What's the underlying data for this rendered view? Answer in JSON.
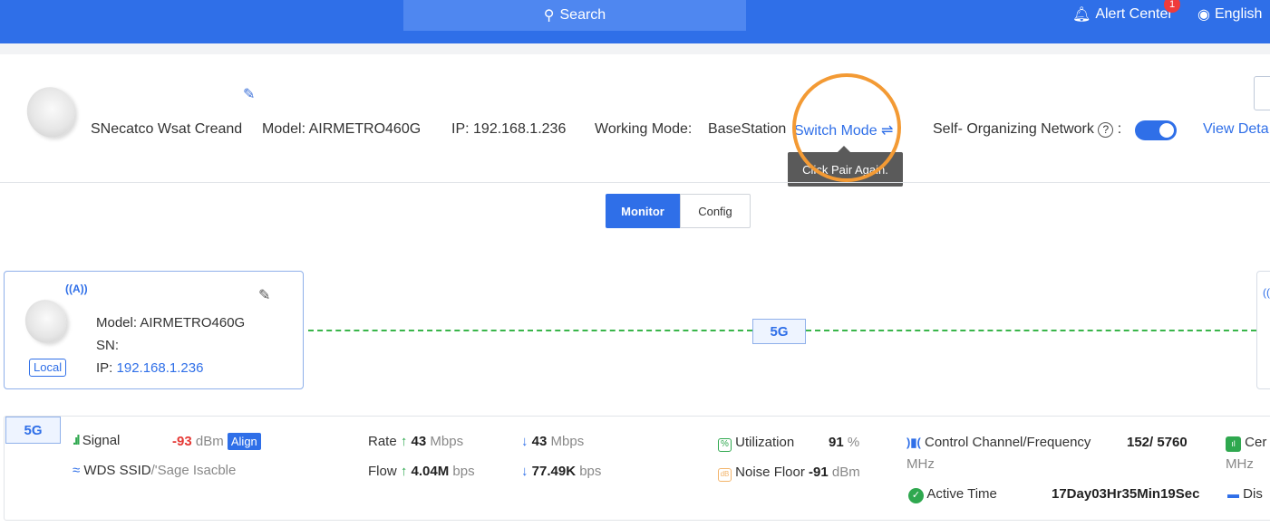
{
  "topbar": {
    "search_label": "Search",
    "alert_label": "Alert Center",
    "alert_count": "1",
    "language_label": "English"
  },
  "device": {
    "name": "SNecatco Wsat Creand",
    "model_text": "Model: AIRMETRO460G",
    "ip_label": "IP:",
    "ip_value": "192.168.1.236",
    "working_mode_label": "Working Mode:",
    "working_mode_value": "BaseStation",
    "switch_mode_label": "Switch Mode",
    "son_label": "Self- Organizing Network",
    "son_help": "?",
    "son_colon": ":",
    "son_enabled": true,
    "view_details_label": "View Deta",
    "tooltip_text": "Click Pair Again."
  },
  "tabs": [
    {
      "label": "Monitor",
      "active": true
    },
    {
      "label": "Config",
      "active": false
    }
  ],
  "local_card": {
    "model_text": "Model: AIRMETRO460G",
    "sn_text": "SN:",
    "ip_label": "IP:",
    "ip_value": "192.168.1.236",
    "tag": "Local"
  },
  "link": {
    "band": "5G",
    "line_color": "#39b54a"
  },
  "stats": {
    "band_tag": "5G",
    "signal_label": "Signal",
    "signal_value": "-93",
    "signal_unit": "dBm",
    "align_label": "Align",
    "wds_label": "WDS SSID",
    "wds_value": "/'Sage Isacble",
    "rate_label": "Rate",
    "rate_up_value": "43",
    "rate_up_unit": "Mbps",
    "rate_down_value": "43",
    "rate_down_unit": "Mbps",
    "flow_label": "Flow",
    "flow_up_value": "4.04M",
    "flow_up_unit": "bps",
    "flow_down_value": "77.49K",
    "flow_down_unit": "bps",
    "utilization_label": "Utilization",
    "utilization_value": "91",
    "utilization_unit": "%",
    "noise_label": "Noise Floor",
    "noise_value": "-91",
    "noise_unit": "dBm",
    "channel_label": "Control Channel/Frequency",
    "channel_value": "152/ 5760",
    "channel_unit": "MHz",
    "active_time_label": "Active Time",
    "active_time_value": "17Day03Hr35Min19Sec",
    "center_label": "Cer",
    "center_unit": "MHz",
    "dis_label": "Dis"
  },
  "colors": {
    "primary": "#2f6fe8",
    "highlight_ring": "#f39a34",
    "link_green": "#39b54a",
    "signal_red": "#e53935"
  }
}
